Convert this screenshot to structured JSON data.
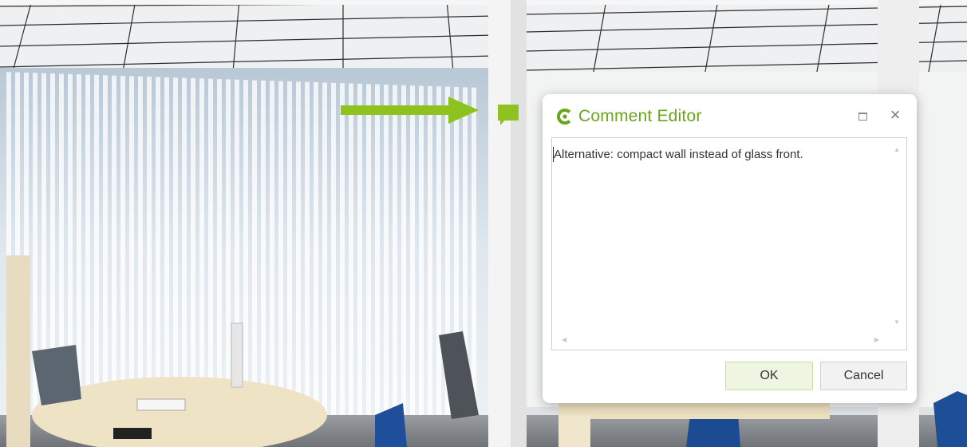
{
  "dialog": {
    "title": "Comment Editor",
    "logo_icon": "app-logo-icon",
    "maximize_icon": "maximize-icon",
    "close_icon": "close-icon",
    "close_glyph": "×",
    "comment_text": "Alternative: compact wall instead of glass front.",
    "ok_label": "OK",
    "cancel_label": "Cancel"
  },
  "scene": {
    "pointer_icon": "arrow-right-icon",
    "marker_icon": "comment-marker-icon"
  },
  "colors": {
    "accent_green": "#8dc21f",
    "title_green": "#6aa51c",
    "ok_button_bg": "#eef5e0"
  }
}
